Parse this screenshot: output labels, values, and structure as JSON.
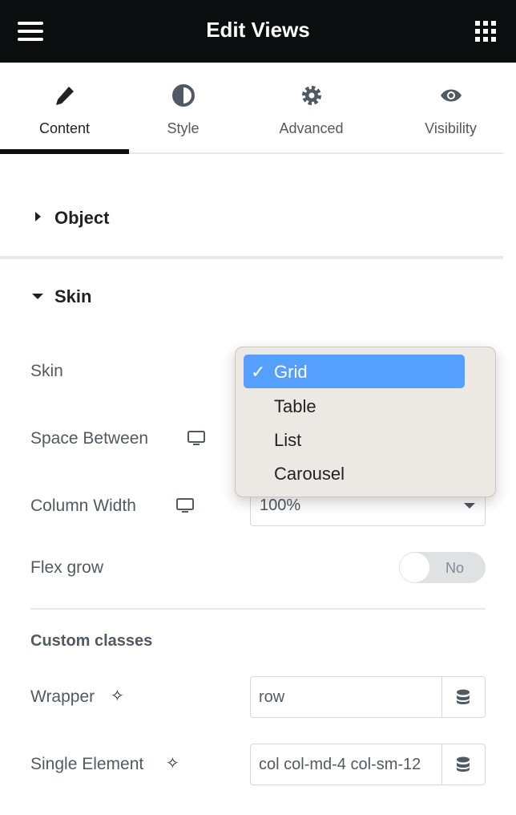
{
  "header": {
    "title": "Edit Views",
    "menu_icon": "hamburger-icon",
    "apps_icon": "grid-apps-icon"
  },
  "tabs": [
    {
      "label": "Content",
      "icon": "pencil-icon",
      "active": true
    },
    {
      "label": "Style",
      "icon": "half-circle-icon"
    },
    {
      "label": "Advanced",
      "icon": "gear-icon"
    },
    {
      "label": "Visibility",
      "icon": "eye-icon"
    }
  ],
  "sections": {
    "object": "Object",
    "skin": "Skin"
  },
  "fields": {
    "skin": {
      "label": "Skin",
      "value": "Grid"
    },
    "space_between": {
      "label": "Space Between"
    },
    "column_width": {
      "label": "Column Width",
      "value": "100%"
    },
    "flex_grow": {
      "label": "Flex grow",
      "toggle": "No",
      "on": false
    },
    "custom_classes": "Custom classes",
    "wrapper": {
      "label": "Wrapper",
      "value": "row"
    },
    "single_element": {
      "label": "Single Element",
      "value": "col col-md-4 col-sm-12"
    }
  },
  "dropdown": {
    "options": [
      "Grid",
      "Table",
      "List",
      "Carousel"
    ],
    "selected": "Grid",
    "checkmark": "✓"
  },
  "colors": {
    "header": "#0c0d0e",
    "highlight": "#55a0fe",
    "menu_bg": "#ece9e4"
  }
}
